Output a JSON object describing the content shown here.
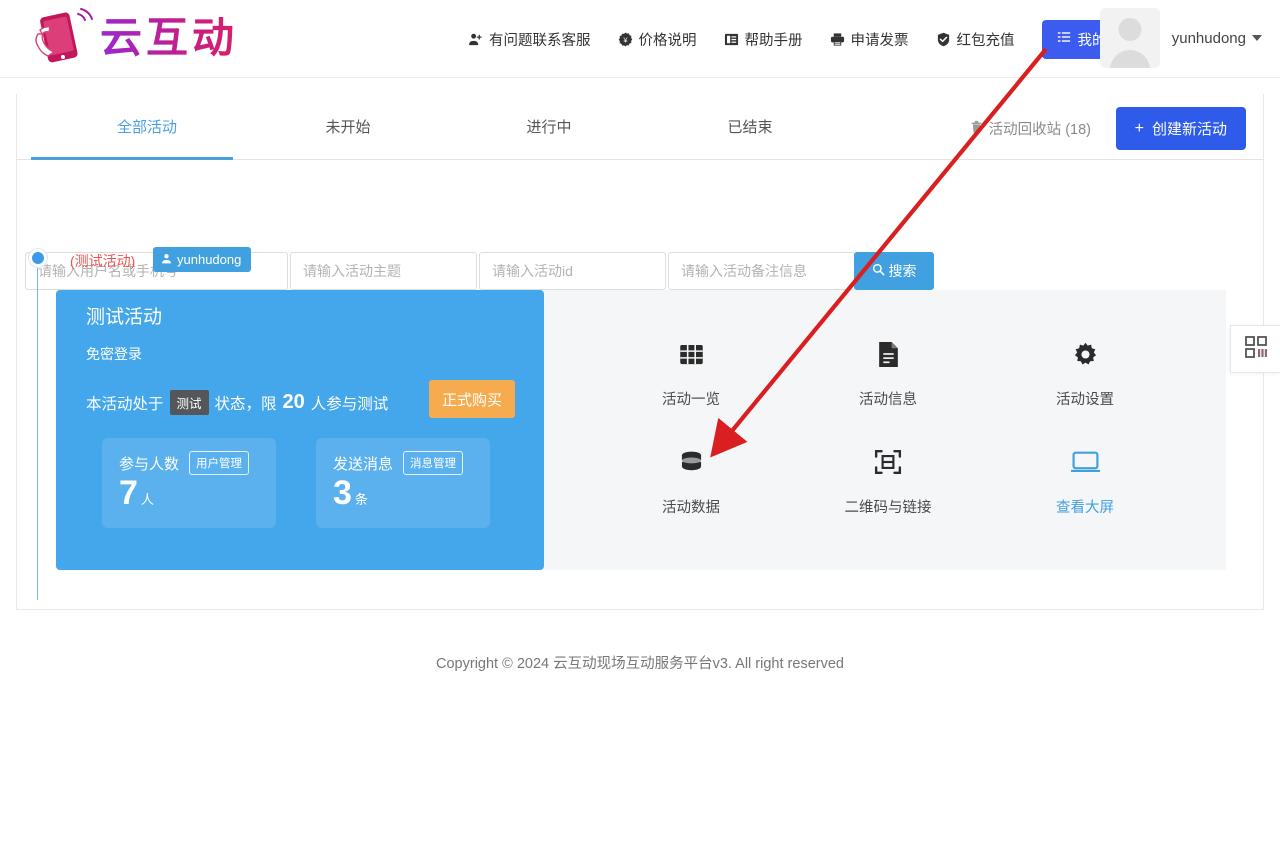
{
  "header": {
    "logo_text": "云互动",
    "logo_icon": "hand-holding-phone-icon",
    "nav": [
      {
        "label": "有问题联系客服",
        "icon": "user-support-icon"
      },
      {
        "label": "价格说明",
        "icon": "price-tag-icon"
      },
      {
        "label": "帮助手册",
        "icon": "book-icon"
      },
      {
        "label": "申请发票",
        "icon": "printer-icon"
      },
      {
        "label": "红包充值",
        "icon": "shield-check-icon"
      }
    ],
    "my_activities": {
      "label": "我的活动",
      "icon": "list-icon"
    },
    "user": {
      "name": "yunhudong",
      "avatar_icon": "user-avatar-placeholder",
      "caret_icon": "chevron-down-icon"
    }
  },
  "tabs": [
    {
      "label": "全部活动",
      "active": true
    },
    {
      "label": "未开始",
      "active": false
    },
    {
      "label": "进行中",
      "active": false
    },
    {
      "label": "已结束",
      "active": false
    }
  ],
  "toolbar": {
    "recycle_bin": {
      "label": "活动回收站 (18)",
      "icon": "trash-icon"
    },
    "create_button": {
      "label": "创建新活动",
      "icon": "plus-icon"
    }
  },
  "filters": {
    "username_placeholder": "请输入用户名或手机号",
    "username_value": "",
    "topic_placeholder": "请输入活动主题",
    "topic_value": "",
    "id_placeholder": "请输入活动id",
    "id_value": "",
    "remark_placeholder": "请输入活动备注信息",
    "remark_value": "",
    "search_button": "搜索",
    "search_icon": "search-icon"
  },
  "activity": {
    "test_tag": "(测试活动)",
    "owner": "yunhudong",
    "owner_icon": "user-icon",
    "title": "测试活动",
    "subtitle": "免密登录",
    "status_prefix": "本活动处于",
    "status_pill": "测试",
    "status_middle": "状态，限",
    "status_limit": "20",
    "status_suffix": "人参与测试",
    "buy_button": "正式购买",
    "stats": [
      {
        "label": "参与人数",
        "chip": "用户管理",
        "value": "7",
        "unit": "人"
      },
      {
        "label": "发送消息",
        "chip": "消息管理",
        "value": "3",
        "unit": "条"
      }
    ],
    "tiles": [
      {
        "label": "活动一览",
        "icon": "grid-table-icon",
        "accent": false
      },
      {
        "label": "活动信息",
        "icon": "document-icon",
        "accent": false
      },
      {
        "label": "活动设置",
        "icon": "gear-icon",
        "accent": false
      },
      {
        "label": "活动数据",
        "icon": "database-icon",
        "accent": false
      },
      {
        "label": "二维码与链接",
        "icon": "qr-scan-icon",
        "accent": false
      },
      {
        "label": "查看大屏",
        "icon": "monitor-icon",
        "accent": true
      }
    ]
  },
  "side_widget": {
    "icon": "qr-grid-icon"
  },
  "footer": {
    "text": "Copyright © 2024 云互动现场互动服务平台v3. All right reserved"
  },
  "annotation": {
    "type": "arrow",
    "color": "#d91f1f",
    "points_to": "活动数据"
  },
  "colors": {
    "primary_blue": "#41a0e0",
    "nav_blue": "#3c5cf0",
    "create_blue": "#2f5bea",
    "card_blue": "#44a7ec",
    "orange": "#f6ab4f",
    "red_tag": "#ef5350",
    "annotation_red": "#d91f1f"
  }
}
